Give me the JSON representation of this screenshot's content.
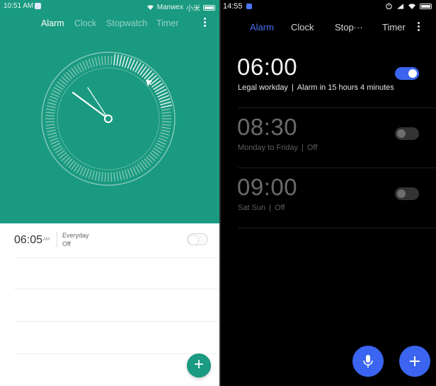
{
  "left": {
    "status": {
      "time": "10:51 AM",
      "carrier": "Manwex",
      "network": "小米"
    },
    "tabs": [
      {
        "label": "Alarm",
        "active": true
      },
      {
        "label": "Clock",
        "active": false
      },
      {
        "label": "Stopwatch",
        "active": false
      },
      {
        "label": "Timer",
        "active": false
      }
    ],
    "alarm": {
      "time": "06:05",
      "ampm": "AM",
      "repeat": "Everyday",
      "state": "Off",
      "enabled": false
    },
    "colors": {
      "accent": "#1a9a80",
      "tab_inactive": "#93d3c4"
    }
  },
  "right": {
    "status": {
      "time": "14:55"
    },
    "tabs": [
      {
        "label": "Alarm",
        "active": true
      },
      {
        "label": "Clock",
        "active": false
      },
      {
        "label": "Stop···",
        "active": false
      },
      {
        "label": "Timer",
        "active": false
      }
    ],
    "alarms": [
      {
        "time": "06:00",
        "repeat": "Legal workday",
        "note": "Alarm in 15 hours 4 minutes",
        "enabled": true
      },
      {
        "time": "08:30",
        "repeat": "Monday to Friday",
        "note": "Off",
        "enabled": false
      },
      {
        "time": "09:00",
        "repeat": "Sat Sun",
        "note": "Off",
        "enabled": false
      }
    ],
    "colors": {
      "accent": "#3b65f0",
      "tab_active": "#4a6ff0"
    }
  }
}
